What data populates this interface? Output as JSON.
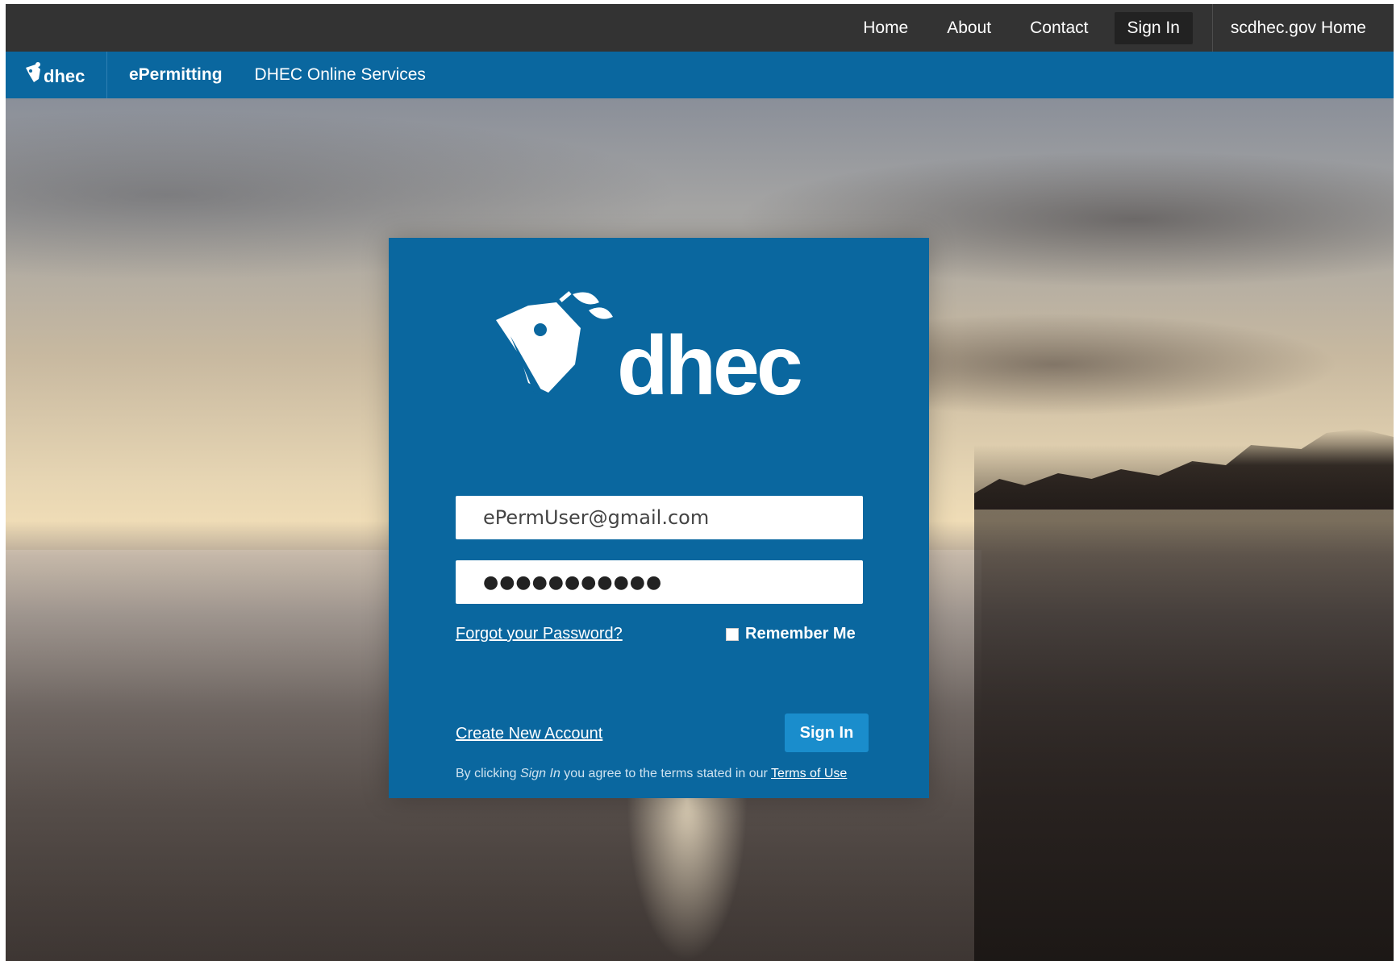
{
  "topnav": {
    "items": [
      "Home",
      "About",
      "Contact",
      "Sign In"
    ],
    "active": "Sign In",
    "external": "scdhec.gov Home"
  },
  "brand": {
    "logo_text": "dhec",
    "app_name": "ePermitting",
    "subtitle": "DHEC Online Services"
  },
  "login": {
    "logo_text": "dhec",
    "email_value": "ePermUser@gmail.com",
    "password_mask": "●●●●●●●●●●●",
    "forgot_label": "Forgot your Password?",
    "remember_label": "Remember Me",
    "remember_checked": false,
    "create_label": "Create New Account",
    "signin_label": "Sign In",
    "terms_prefix": "By clicking",
    "terms_em": "Sign In",
    "terms_middle": "you agree to the terms stated in our",
    "terms_link": "Terms of Use"
  },
  "colors": {
    "topbar": "#333333",
    "brand_blue": "#0a679f",
    "button_blue": "#1a8dcc"
  }
}
